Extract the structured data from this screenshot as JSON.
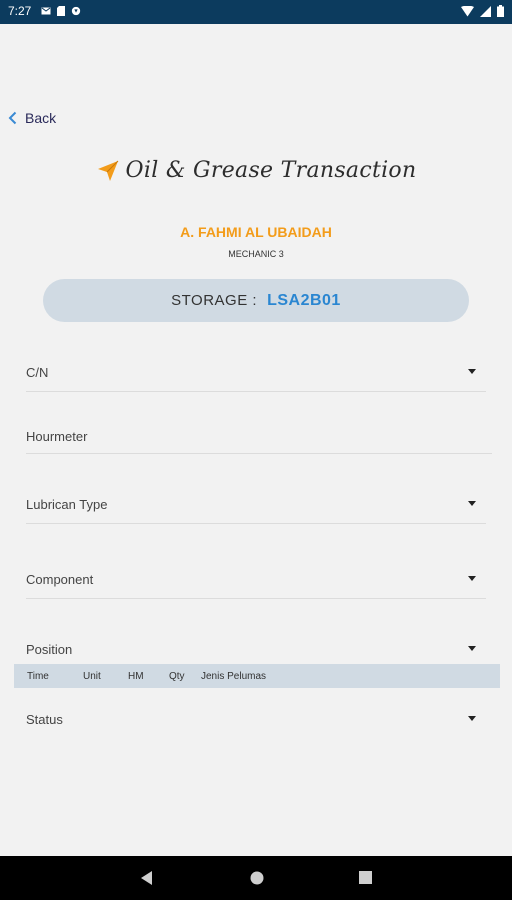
{
  "status_bar": {
    "time": "7:27"
  },
  "nav": {
    "back_label": "Back"
  },
  "header": {
    "title": "Oil & Grease Transaction"
  },
  "user": {
    "name": "A. FAHMI AL UBAIDAH",
    "role": "MECHANIC 3"
  },
  "storage": {
    "label": "STORAGE :",
    "value": "LSA2B01"
  },
  "fields": {
    "cn": "C/N",
    "hourmeter": "Hourmeter",
    "lubrican_type": "Lubrican Type",
    "component": "Component",
    "position": "Position",
    "status": "Status"
  },
  "table": {
    "columns": [
      "Time",
      "Unit",
      "HM",
      "Qty",
      "Jenis Pelumas"
    ]
  },
  "colors": {
    "status_bar": "#0c3b5e",
    "accent_orange": "#f39c1a",
    "storage_value": "#2a86d1",
    "storage_bg": "#d0dae3"
  }
}
